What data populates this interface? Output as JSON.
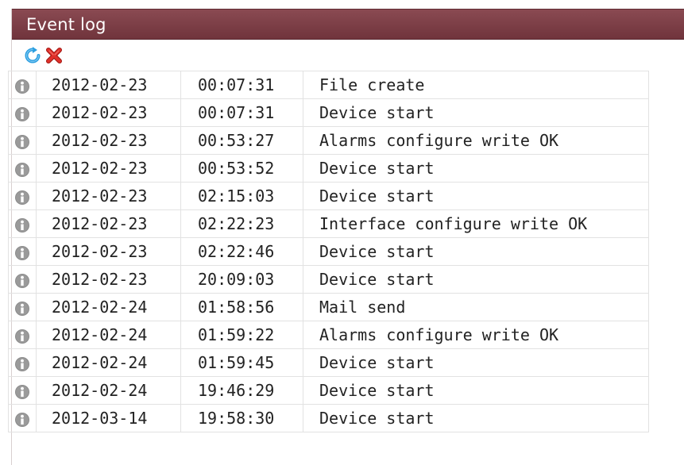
{
  "window": {
    "title": "Event log"
  },
  "toolbar": {
    "refresh_icon": "refresh-icon",
    "delete_icon": "delete-icon",
    "refresh_color": "#2a9ee0",
    "delete_color": "#d9251c"
  },
  "colors": {
    "titlebar": "#7a3c44",
    "info_icon": "#8c8c8c"
  },
  "events": {
    "row_icon": "info-icon",
    "rows": [
      {
        "date": "2012-02-23",
        "time": "00:07:31",
        "message": "File create"
      },
      {
        "date": "2012-02-23",
        "time": "00:07:31",
        "message": "Device start"
      },
      {
        "date": "2012-02-23",
        "time": "00:53:27",
        "message": "Alarms configure write OK"
      },
      {
        "date": "2012-02-23",
        "time": "00:53:52",
        "message": "Device start"
      },
      {
        "date": "2012-02-23",
        "time": "02:15:03",
        "message": "Device start"
      },
      {
        "date": "2012-02-23",
        "time": "02:22:23",
        "message": "Interface configure write OK"
      },
      {
        "date": "2012-02-23",
        "time": "02:22:46",
        "message": "Device start"
      },
      {
        "date": "2012-02-23",
        "time": "20:09:03",
        "message": "Device start"
      },
      {
        "date": "2012-02-24",
        "time": "01:58:56",
        "message": "Mail send"
      },
      {
        "date": "2012-02-24",
        "time": "01:59:22",
        "message": "Alarms configure write OK"
      },
      {
        "date": "2012-02-24",
        "time": "01:59:45",
        "message": "Device start"
      },
      {
        "date": "2012-02-24",
        "time": "19:46:29",
        "message": "Device start"
      },
      {
        "date": "2012-03-14",
        "time": "19:58:30",
        "message": "Device start"
      }
    ]
  }
}
